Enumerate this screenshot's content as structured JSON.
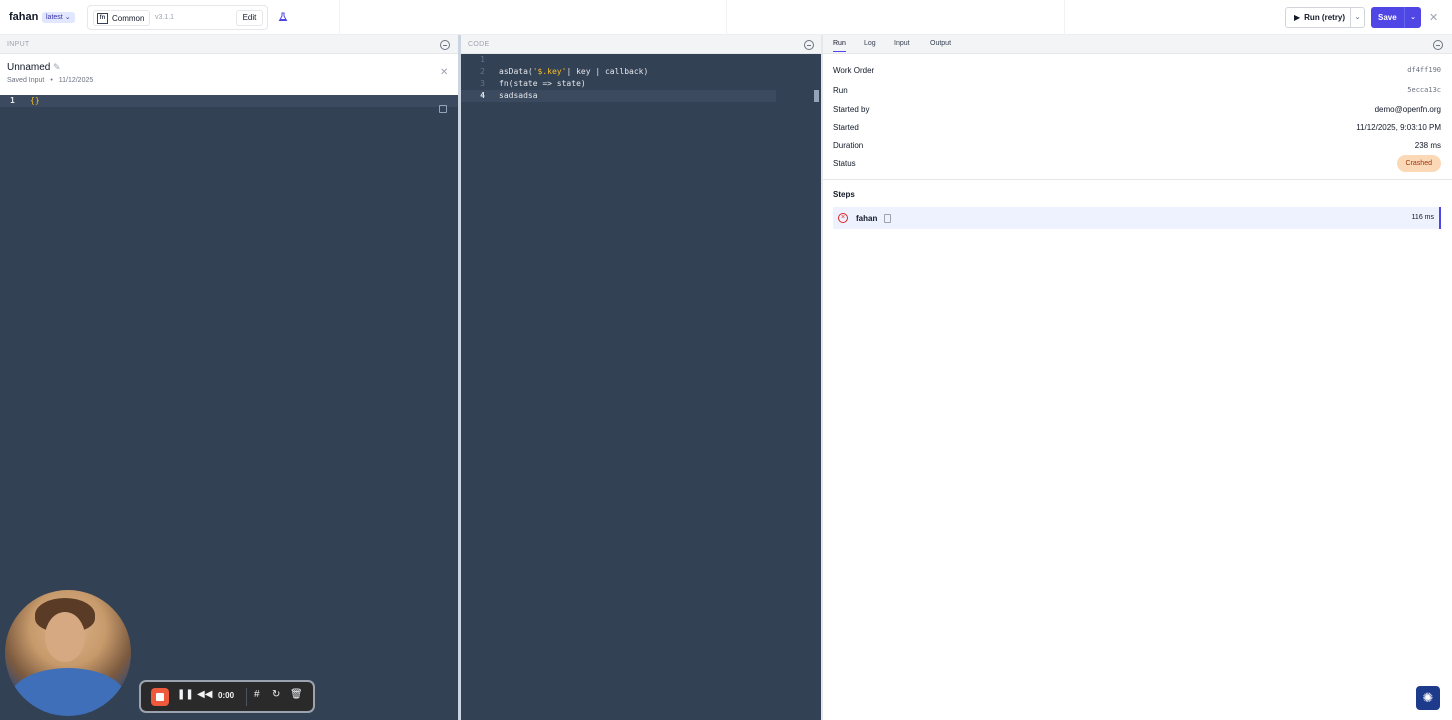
{
  "topbar": {
    "job_name": "fahan",
    "version": "latest",
    "adaptor_icon": "fn",
    "adaptor_name": "Common",
    "adaptor_version": "v3.1.1",
    "edit_label": "Edit",
    "run_label": "Run (retry)",
    "save_label": "Save",
    "close": "✕"
  },
  "input_panel": {
    "title": "INPUT",
    "name": "Unnamed",
    "saved_label": "Saved Input",
    "dot": "•",
    "saved_date": "11/12/2025",
    "close": "✕",
    "lines": [
      {
        "num": "1",
        "text": "{}"
      }
    ]
  },
  "code_panel": {
    "title": "CODE",
    "lines": [
      {
        "num": "1",
        "text": ""
      },
      {
        "num": "2",
        "pre": "asData(",
        "str": "'$.key'",
        "post": "| key | callback)"
      },
      {
        "num": "3",
        "text": "fn(state => state)"
      },
      {
        "num": "4",
        "text": "sadsadsa"
      }
    ]
  },
  "run_panel": {
    "tabs": [
      "Run",
      "Log",
      "Input",
      "Output"
    ],
    "active_tab": "Run",
    "fields": {
      "work_order_label": "Work Order",
      "work_order": "df4ff190",
      "run_label": "Run",
      "run": "5ecca13c",
      "started_by_label": "Started by",
      "started_by": "demo@openfn.org",
      "started_label": "Started",
      "started": "11/12/2025, 9:03:10 PM",
      "duration_label": "Duration",
      "duration": "238 ms",
      "status_label": "Status",
      "status": "Crashed"
    },
    "status_color": "#fcd9b6",
    "steps_title": "Steps",
    "steps": [
      {
        "name": "fahan",
        "duration": "116 ms",
        "state_icon": "x-circle-icon"
      }
    ]
  },
  "recorder": {
    "time": "0:00"
  },
  "colors": {
    "accent": "#4f46e5",
    "editor_bg": "#334155"
  }
}
